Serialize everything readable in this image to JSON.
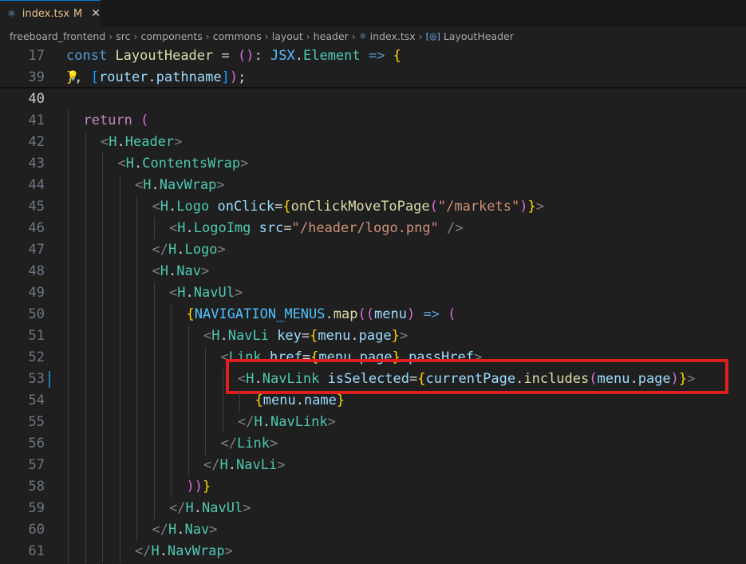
{
  "tab": {
    "icon": "react-icon",
    "filename": "index.tsx",
    "status": "M",
    "close": "✕"
  },
  "breadcrumb": {
    "segments": [
      "freeboard_frontend",
      "src",
      "components",
      "commons",
      "layout",
      "header",
      "index.tsx",
      "LayoutHeader"
    ],
    "separator": "›"
  },
  "lines": [
    {
      "num": "17",
      "text": "const LayoutHeader = (): JSX.Element => {"
    },
    {
      "num": "39",
      "text": "}, [router.pathname]);"
    },
    {
      "num": "40",
      "text": ""
    },
    {
      "num": "41",
      "text": "return ("
    },
    {
      "num": "42",
      "text": "<H.Header>"
    },
    {
      "num": "43",
      "text": "<H.ContentsWrap>"
    },
    {
      "num": "44",
      "text": "<H.NavWrap>"
    },
    {
      "num": "45",
      "text": "<H.Logo onClick={onClickMoveToPage(\"/markets\")}>"
    },
    {
      "num": "46",
      "text": "<H.LogoImg src=\"/header/logo.png\" />"
    },
    {
      "num": "47",
      "text": "</H.Logo>"
    },
    {
      "num": "48",
      "text": "<H.Nav>"
    },
    {
      "num": "49",
      "text": "<H.NavUl>"
    },
    {
      "num": "50",
      "text": "{NAVIGATION_MENUS.map((menu) => ("
    },
    {
      "num": "51",
      "text": "<H.NavLi key={menu.page}>"
    },
    {
      "num": "52",
      "text": "<Link href={menu.page} passHref>"
    },
    {
      "num": "53",
      "text": "<H.NavLink isSelected={currentPage.includes(menu.page)}>"
    },
    {
      "num": "54",
      "text": "{menu.name}"
    },
    {
      "num": "55",
      "text": "</H.NavLink>"
    },
    {
      "num": "56",
      "text": "</Link>"
    },
    {
      "num": "57",
      "text": "</H.NavLi>"
    },
    {
      "num": "58",
      "text": "))}"
    },
    {
      "num": "59",
      "text": "</H.NavUl>"
    },
    {
      "num": "60",
      "text": "</H.Nav>"
    },
    {
      "num": "61",
      "text": "</H.NavWrap>"
    }
  ],
  "colors": {
    "highlight_box": "#e01e1e",
    "background": "#1f1f1f"
  }
}
